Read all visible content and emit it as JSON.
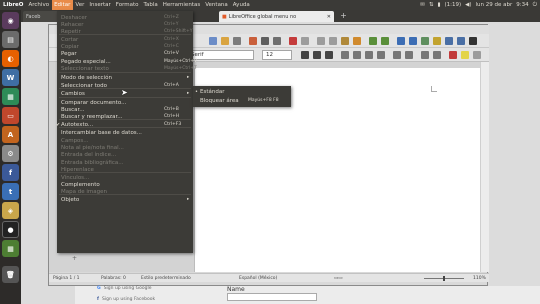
{
  "topbar": {
    "app_name": "LibreO",
    "menus": [
      "Archivo",
      "Editar",
      "Ver",
      "Insertar",
      "Formato",
      "Tabla",
      "Herramientas",
      "Ventana",
      "Ayuda"
    ],
    "battery": "(1:19)",
    "volume_icon": "speaker-icon",
    "date": "lun 29 de abr",
    "time": "9:34"
  },
  "browser": {
    "tab_facebook": "Faceb",
    "tab_active": "LibreOffice global menu no",
    "new_tab": "+"
  },
  "toolbar": {
    "font_name": "Serif",
    "font_size": "12"
  },
  "edit_menu": {
    "items": [
      {
        "label": "Deshacer",
        "shortcut": "Ctrl+Z",
        "disabled": true
      },
      {
        "label": "Rehacer",
        "shortcut": "Ctrl+Y",
        "disabled": true
      },
      {
        "label": "Repetir",
        "shortcut": "Ctrl+Shift+Y",
        "disabled": true
      },
      {
        "label": "Cortar",
        "shortcut": "Ctrl+X",
        "disabled": true
      },
      {
        "label": "Copiar",
        "shortcut": "Ctrl+C",
        "disabled": true
      },
      {
        "label": "Pegar",
        "shortcut": "Ctrl+V",
        "disabled": false
      },
      {
        "label": "Pegado especial...",
        "shortcut": "Mayús+Ctrl+V",
        "disabled": false
      },
      {
        "label": "Seleccionar texto",
        "shortcut": "Mayús+Ctrl+T",
        "disabled": true
      },
      {
        "label": "Modo de selección",
        "shortcut": "",
        "disabled": false,
        "submenu": true
      },
      {
        "label": "Seleccionar todo",
        "shortcut": "Ctrl+A",
        "disabled": false
      },
      {
        "label": "Cambios",
        "shortcut": "",
        "disabled": false,
        "submenu": true
      },
      {
        "label": "Comparar documento...",
        "shortcut": "",
        "disabled": false
      },
      {
        "label": "Buscar...",
        "shortcut": "Ctrl+B",
        "disabled": false
      },
      {
        "label": "Buscar y reemplazar...",
        "shortcut": "Ctrl+H",
        "disabled": false
      },
      {
        "label": "Autotexto...",
        "shortcut": "Ctrl+F3",
        "disabled": false,
        "checked": true
      },
      {
        "label": "Intercambiar base de datos...",
        "shortcut": "",
        "disabled": false
      },
      {
        "label": "Campos...",
        "shortcut": "",
        "disabled": true
      },
      {
        "label": "Nota al pie/nota final...",
        "shortcut": "",
        "disabled": true
      },
      {
        "label": "Entrada del índice...",
        "shortcut": "",
        "disabled": true
      },
      {
        "label": "Entrada bibliográfica...",
        "shortcut": "",
        "disabled": true
      },
      {
        "label": "Hiperenlace",
        "shortcut": "",
        "disabled": true
      },
      {
        "label": "Vínculos...",
        "shortcut": "",
        "disabled": true
      },
      {
        "label": "Complemento",
        "shortcut": "",
        "disabled": false
      },
      {
        "label": "Mapa de imagen",
        "shortcut": "",
        "disabled": true
      },
      {
        "label": "Objeto",
        "shortcut": "",
        "disabled": false,
        "submenu": true
      }
    ]
  },
  "submenu": {
    "items": [
      {
        "label": "Estándar",
        "shortcut": "",
        "selected": true
      },
      {
        "label": "Bloquear área",
        "shortcut": "Mayús+F8 F8",
        "selected": false
      }
    ]
  },
  "statusbar": {
    "page": "Página 1 / 1",
    "words": "Palabras: 0",
    "style": "Estilo predeterminado",
    "language": "Español (México)",
    "zoom": "110%"
  },
  "web_bottom": {
    "google_signup": "Sign up using Google",
    "facebook_signup": "Sign up using Facebook",
    "name_label": "Name"
  },
  "colors": {
    "menu_bg": "#3c3b37",
    "menu_text": "#dfdbd2",
    "disabled_text": "#7e7c75",
    "accent": "#e98c4a"
  }
}
